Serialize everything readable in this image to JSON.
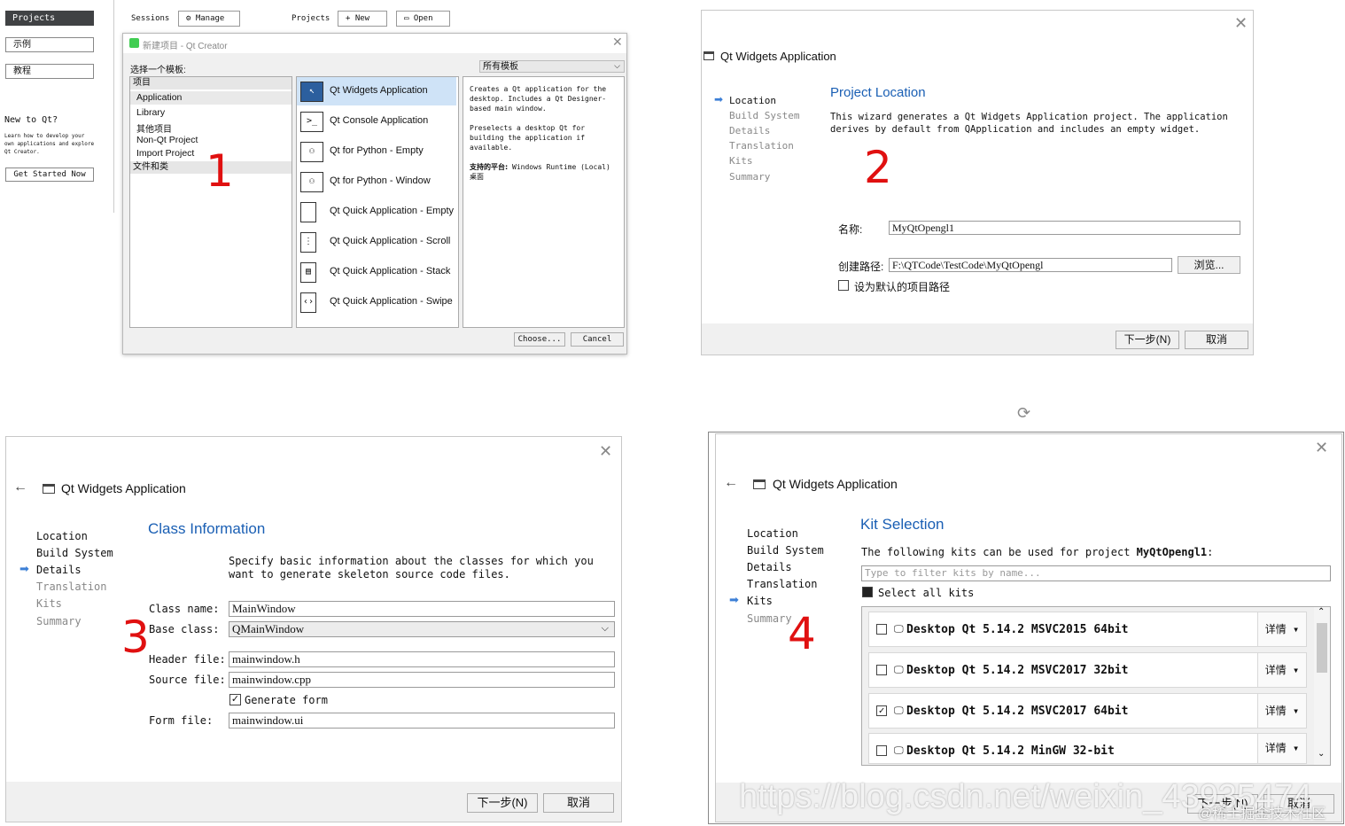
{
  "q1": {
    "left": {
      "projects_btn": "Projects",
      "examples_btn": "示例",
      "tutorials_btn": "教程",
      "new_to_qt": "New to Qt?",
      "learn_text": "Learn how to develop your own applications and explore Qt Creator.",
      "get_started": "Get Started Now"
    },
    "topbar": {
      "sessions": "Sessions",
      "manage": "Manage",
      "projects": "Projects",
      "new": "New",
      "open": "Open"
    },
    "dialog": {
      "title": "新建项目 - Qt Creator",
      "choose_template": "选择一个模板:",
      "filter": "所有模板",
      "categories": [
        "项目",
        "Application",
        "Library",
        "其他项目",
        "Non-Qt Project",
        "Import Project",
        "文件和类"
      ],
      "templates": [
        {
          "label": "Qt Widgets Application",
          "icon": "window-cursor-icon"
        },
        {
          "label": "Qt Console Application",
          "icon": "console-icon"
        },
        {
          "label": "Qt for Python - Empty",
          "icon": "python-icon"
        },
        {
          "label": "Qt for Python - Window",
          "icon": "python-window-icon"
        },
        {
          "label": "Qt Quick Application - Empty",
          "icon": "quick-empty-icon"
        },
        {
          "label": "Qt Quick Application - Scroll",
          "icon": "quick-scroll-icon"
        },
        {
          "label": "Qt Quick Application - Stack",
          "icon": "quick-stack-icon"
        },
        {
          "label": "Qt Quick Application - Swipe",
          "icon": "quick-swipe-icon"
        }
      ],
      "desc1": "Creates a Qt application for the desktop. Includes a Qt Designer-based main window.",
      "desc2": "Preselects a desktop Qt for building the application if available.",
      "platform_label": "支持的平台:",
      "platform_value": "Windows Runtime (Local) 桌面",
      "choose_btn": "Choose...",
      "cancel_btn": "Cancel"
    },
    "step_number": "1"
  },
  "q2": {
    "window_title": "Qt Widgets Application",
    "nav": [
      "Location",
      "Build System",
      "Details",
      "Translation",
      "Kits",
      "Summary"
    ],
    "heading": "Project Location",
    "intro": "This wizard generates a Qt Widgets Application project. The application derives by default from QApplication and includes an empty widget.",
    "name_label": "名称:",
    "name_value": "MyQtOpengl1",
    "path_label": "创建路径:",
    "path_value": "F:\\QTCode\\TestCode\\MyQtOpengl",
    "browse_btn": "浏览...",
    "default_path_label": "设为默认的项目路径",
    "next_btn": "下一步(N)",
    "cancel_btn": "取消",
    "step_number": "2"
  },
  "q3": {
    "window_title": "Qt Widgets Application",
    "nav": [
      "Location",
      "Build System",
      "Details",
      "Translation",
      "Kits",
      "Summary"
    ],
    "heading": "Class Information",
    "intro": "Specify basic information about the classes for which you want to generate skeleton source code files.",
    "class_name_label": "Class name:",
    "class_name_value": "MainWindow",
    "base_class_label": "Base class:",
    "base_class_value": "QMainWindow",
    "header_file_label": "Header file:",
    "header_file_value": "mainwindow.h",
    "source_file_label": "Source file:",
    "source_file_value": "mainwindow.cpp",
    "generate_form_label": "Generate form",
    "form_file_label": "Form file:",
    "form_file_value": "mainwindow.ui",
    "next_btn": "下一步(N)",
    "cancel_btn": "取消",
    "step_number": "3"
  },
  "q4": {
    "window_title": "Qt Widgets Application",
    "nav": [
      "Location",
      "Build System",
      "Details",
      "Translation",
      "Kits",
      "Summary"
    ],
    "heading": "Kit Selection",
    "intro_prefix": "The following kits can be used for project ",
    "intro_project": "MyQtOpengl1",
    "intro_suffix": ":",
    "filter_placeholder": "Type to filter kits by name...",
    "select_all": "Select all kits",
    "kits": [
      {
        "name": "Desktop Qt 5.14.2 MSVC2015 64bit",
        "checked": false,
        "details": "详情"
      },
      {
        "name": "Desktop Qt 5.14.2 MSVC2017 32bit",
        "checked": false,
        "details": "详情"
      },
      {
        "name": "Desktop Qt 5.14.2 MSVC2017 64bit",
        "checked": true,
        "details": "详情"
      },
      {
        "name": "Desktop Qt 5.14.2 MinGW 32-bit",
        "checked": false,
        "details": "详情"
      }
    ],
    "next_btn": "下一步(N)",
    "cancel_btn": "取消",
    "step_number": "4"
  },
  "watermark": "https://blog.csdn.net/weixin_43935474",
  "watermark2": "@稀土掘金技术社区",
  "colors": {
    "accent_blue": "#1a5fb4",
    "step_red": "#e01010",
    "selected_bg": "#cfe3f7"
  }
}
